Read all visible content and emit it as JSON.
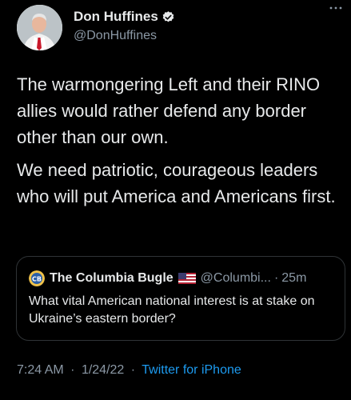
{
  "author": {
    "name": "Don Huffines",
    "handle": "@DonHuffines",
    "verified": true,
    "avatar_icon": "profile-photo-man-suit-red-tie"
  },
  "more_icon": "ellipsis-icon",
  "body": {
    "paragraph_1": "The warmongering Left and their RINO allies would rather defend any border other than our own.",
    "paragraph_2": "We need patriotic, courageous leaders who will put America and Americans first."
  },
  "quoted_tweet": {
    "name": "The Columbia Bugle",
    "flag": "us-flag-emoji",
    "handle": "@Columbi...",
    "separator": "·",
    "time": "25m",
    "text": "What vital American national interest is at stake on Ukraine’s eastern border?"
  },
  "meta": {
    "time": "7:24 AM",
    "separator_1": "·",
    "date": "1/24/22",
    "separator_2": "·",
    "source": "Twitter for iPhone"
  },
  "colors": {
    "background": "#000000",
    "text": "#e7e9ea",
    "secondary": "#8b98a5",
    "link": "#1d9bf0",
    "border": "#2f3336",
    "verified": "#1d9bf0"
  }
}
